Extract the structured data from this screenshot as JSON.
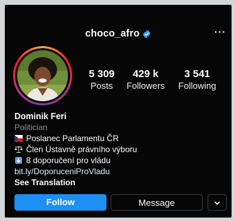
{
  "header": {
    "username": "choco_afro",
    "verified_icon": "verified-badge-icon",
    "more_icon": "more-options-icon",
    "more_label": "···"
  },
  "stats": [
    {
      "value": "5 309",
      "label": "Posts"
    },
    {
      "value": "429 k",
      "label": "Followers"
    },
    {
      "value": "3 541",
      "label": "Following"
    }
  ],
  "bio": {
    "name": "Dominik Feri",
    "category": "Politician",
    "lines": [
      {
        "icon": "czech-flag-icon",
        "text": "Poslanec Parlamentu ČR"
      },
      {
        "icon": "scales-icon",
        "text": "Člen Ústavně právního výboru"
      },
      {
        "icon": "down-arrow-box-icon",
        "text": "8 doporučení pro vládu"
      }
    ],
    "link": "bit.ly/DoporuceniProVladu",
    "see_translation": "See Translation"
  },
  "actions": {
    "follow_label": "Follow",
    "message_label": "Message",
    "dropdown_icon": "chevron-down-icon"
  },
  "colors": {
    "background": "#060606",
    "follow_button": "#1c90f3",
    "verified": "#3797f0",
    "category_text": "#8e8e8e"
  }
}
